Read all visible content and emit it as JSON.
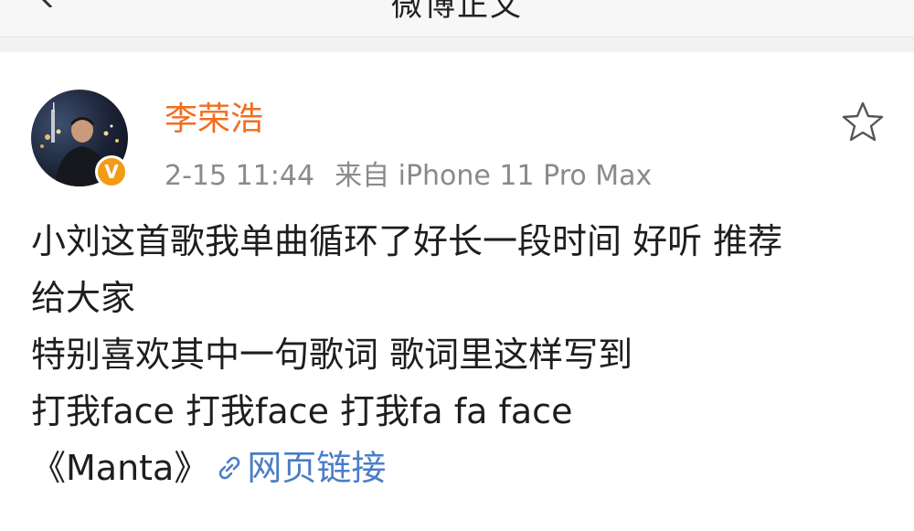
{
  "header": {
    "title": "微博正文"
  },
  "post": {
    "author": "李荣浩",
    "verified_mark": "V",
    "timestamp": "2-15 11:44",
    "source": "来自 iPhone 11 Pro Max",
    "lines": [
      "小刘这首歌我单曲循环了好长一段时间 好听 推荐",
      "给大家",
      "特别喜欢其中一句歌词 歌词里这样写到",
      "打我face 打我face 打我fa fa face"
    ],
    "song_title": "《Manta》",
    "link_label": "网页链接"
  },
  "colors": {
    "username": "#f26d1d",
    "link": "#4a7ec5",
    "verified_badge": "#f29b17",
    "meta_text": "#8a8a8a"
  },
  "icons": {
    "back": "chevron-left-icon",
    "favorite": "star-outline-icon",
    "link": "link-icon"
  }
}
